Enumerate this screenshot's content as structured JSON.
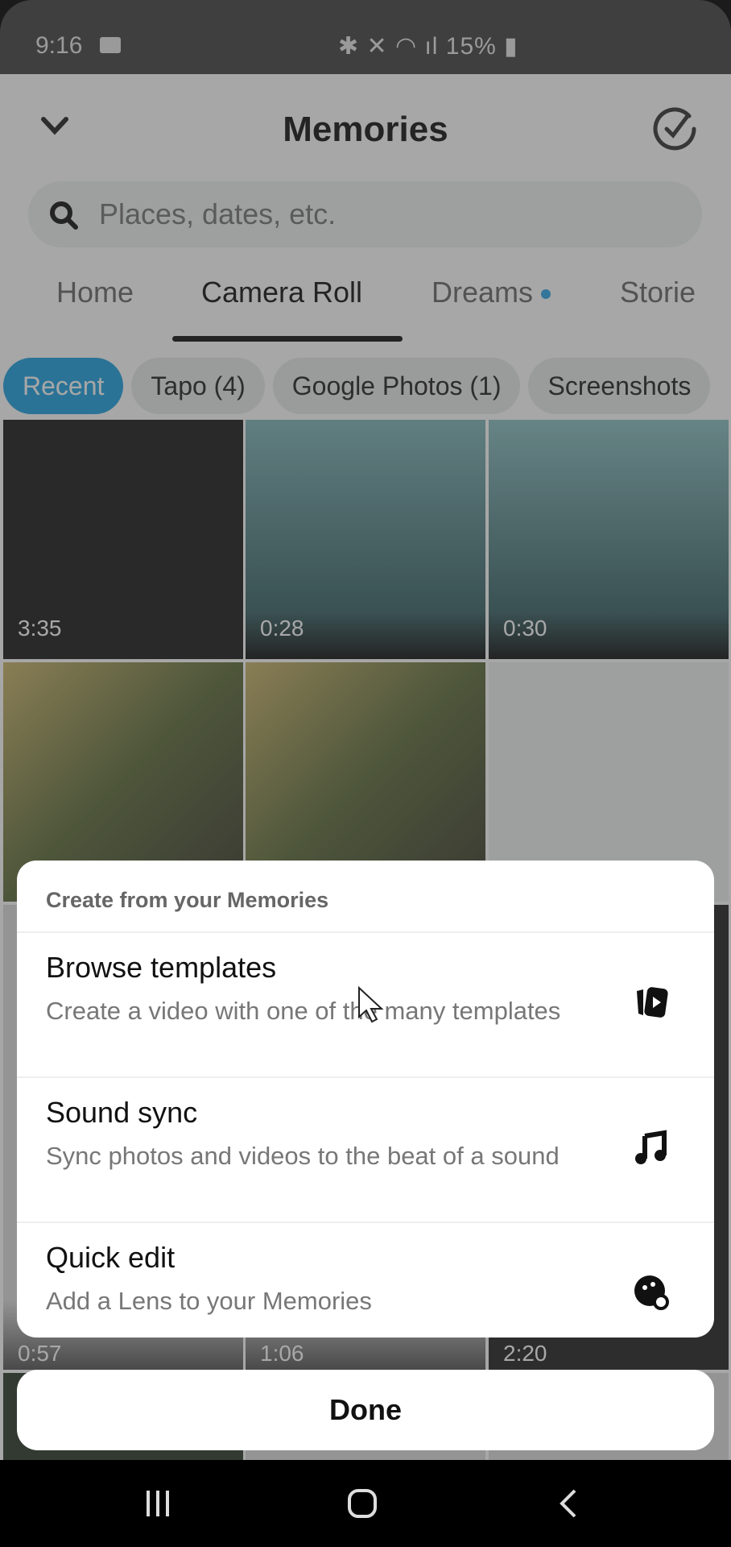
{
  "status_bar": {
    "time": "9:16",
    "battery": "15%"
  },
  "header": {
    "title": "Memories"
  },
  "search": {
    "placeholder": "Places, dates, etc."
  },
  "tabs": [
    {
      "label": "Home"
    },
    {
      "label": "Camera Roll",
      "active": true
    },
    {
      "label": "Dreams",
      "has_dot": true
    },
    {
      "label": "Storie"
    }
  ],
  "chips": [
    {
      "label": "Recent",
      "active": true
    },
    {
      "label": "Tapo (4)"
    },
    {
      "label": "Google Photos (1)"
    },
    {
      "label": "Screenshots"
    }
  ],
  "grid": {
    "durations": [
      "3:35",
      "0:28",
      "0:30",
      "",
      "",
      "",
      "0:57",
      "1:06",
      "2:20"
    ]
  },
  "sheet": {
    "title": "Create from your Memories",
    "items": [
      {
        "title": "Browse templates",
        "description": "Create a video with one of the many templates",
        "icon": "templates-icon"
      },
      {
        "title": "Sound sync",
        "description": "Sync photos and videos to the beat of a sound",
        "icon": "music-note-icon"
      },
      {
        "title": "Quick edit",
        "description": "Add a Lens to your Memories",
        "icon": "lens-icon"
      }
    ],
    "done_label": "Done"
  },
  "colors": {
    "accent": "#1ea1e0",
    "status_bar": "#424242"
  }
}
